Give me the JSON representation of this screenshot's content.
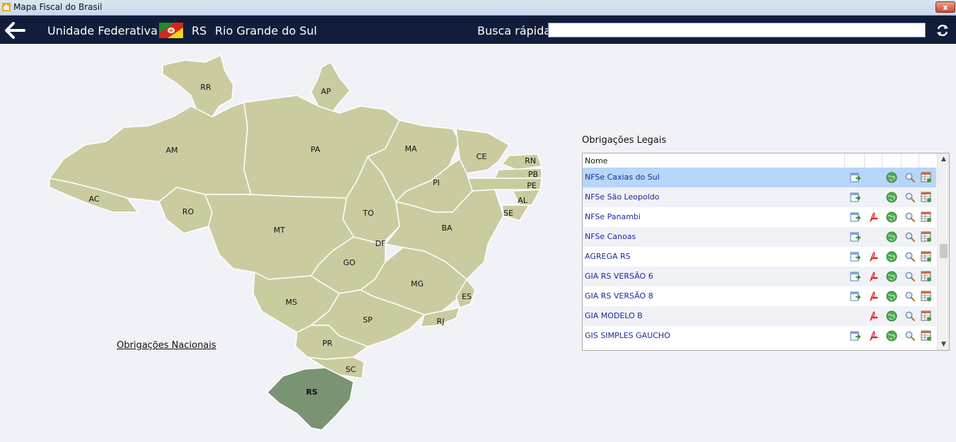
{
  "window": {
    "title": "Mapa Fiscal do Brasil",
    "close_label": "x"
  },
  "header": {
    "uf_label": "Unidade Federativa",
    "uf_code": "RS",
    "uf_name": "Rio Grande do Sul",
    "busca_label": "Busca rápida",
    "busca_value": ""
  },
  "map": {
    "states": [
      "RR",
      "AP",
      "AM",
      "PA",
      "MA",
      "CE",
      "RN",
      "PB",
      "PE",
      "AL",
      "SE",
      "PI",
      "AC",
      "RO",
      "TO",
      "BA",
      "MT",
      "DF",
      "GO",
      "MG",
      "ES",
      "MS",
      "SP",
      "RJ",
      "PR",
      "SC",
      "RS"
    ],
    "selected": "RS",
    "colors": {
      "state": "#cbcba0",
      "selected": "#7a9373",
      "border": "#ffffff"
    }
  },
  "nacionais_link": "Obrigações Nacionais",
  "obrigacoes": {
    "title": "Obrigações Legais",
    "column_name": "Nome",
    "rows": [
      {
        "name": "NFSe Caxias do Sul",
        "icons": [
          "export-icon",
          "",
          "globe-icon",
          "search-icon",
          "table-icon"
        ]
      },
      {
        "name": "NFSe São Leopoldo",
        "icons": [
          "export-icon",
          "",
          "globe-icon",
          "search-icon",
          "table-icon"
        ]
      },
      {
        "name": "NFSe Panambi",
        "icons": [
          "export-icon",
          "pdf-icon",
          "globe-icon",
          "search-icon",
          "table-icon"
        ]
      },
      {
        "name": "NFSe Canoas",
        "icons": [
          "export-icon",
          "",
          "globe-icon",
          "search-icon",
          "table-icon"
        ]
      },
      {
        "name": "AGREGA RS",
        "icons": [
          "export-icon",
          "pdf-icon",
          "globe-icon",
          "search-icon",
          "table-icon"
        ]
      },
      {
        "name": "GIA RS VERSÃO 6",
        "icons": [
          "export-icon",
          "pdf-icon",
          "globe-icon",
          "search-icon",
          "table-icon"
        ]
      },
      {
        "name": "GIA RS VERSÃO 8",
        "icons": [
          "export-icon",
          "pdf-icon",
          "globe-icon",
          "search-icon",
          "table-icon"
        ]
      },
      {
        "name": "GIA MODELO B",
        "icons": [
          "",
          "pdf-icon",
          "globe-icon",
          "search-icon",
          "table-icon"
        ]
      },
      {
        "name": "GIS SIMPLES GAUCHO",
        "icons": [
          "export-icon",
          "pdf-icon",
          "globe-icon",
          "search-icon",
          "table-icon"
        ]
      }
    ],
    "selected_index": 0
  }
}
